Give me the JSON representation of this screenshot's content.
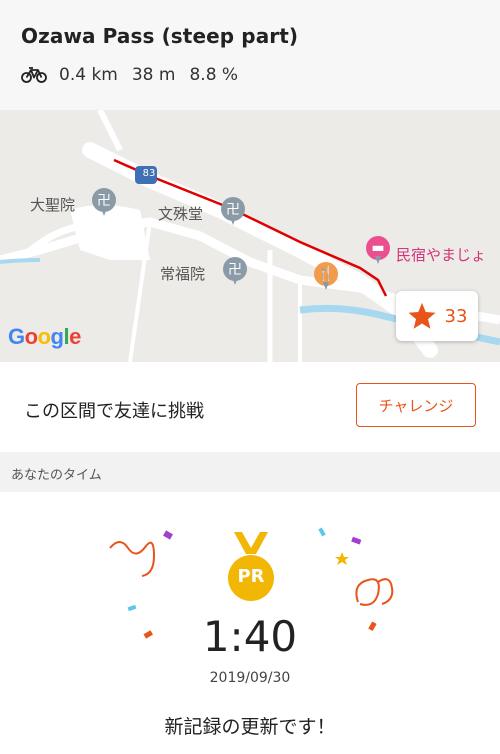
{
  "segment": {
    "title": "Ozawa Pass (steep part)",
    "distance": "0.4 km",
    "elevation": "38 m",
    "grade": "8.8 %"
  },
  "map": {
    "route_badge": "83",
    "places": {
      "daishoin": "大聖院",
      "monjudo": "文殊堂",
      "jofukuin": "常福院",
      "minshuku": "民宿やまじょ"
    },
    "attribution": {
      "g1": "G",
      "o1": "o",
      "o2": "o",
      "g2": "g",
      "l": "l",
      "e": "e"
    },
    "star_count": "33"
  },
  "challenge": {
    "prompt": "この区間で友達に挑戦",
    "button_label": "チャレンジ"
  },
  "your_time": {
    "section_label": "あなたのタイム",
    "medal_text": "PR",
    "time": "1:40",
    "date": "2019/09/30",
    "message": "新記録の更新です！"
  },
  "colors": {
    "accent": "#e8541a",
    "route": "#e00000",
    "medal_gold": "#f2b705"
  }
}
